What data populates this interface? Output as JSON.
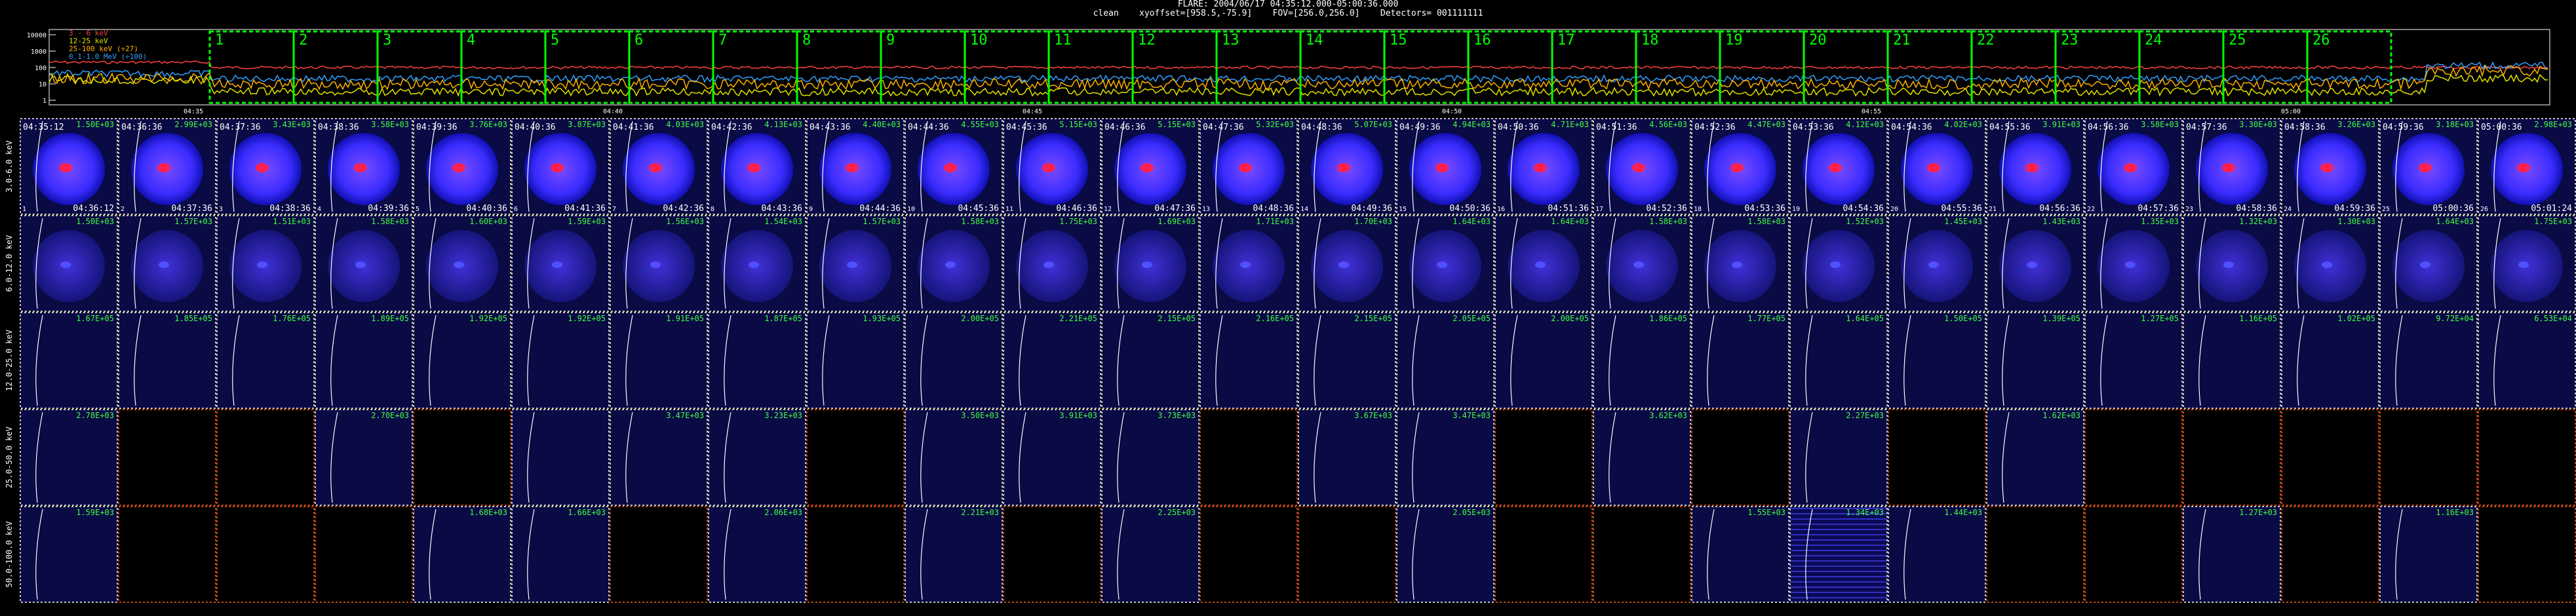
{
  "header": {
    "title": "FLARE: 2004/06/17 04:35:12.000-05:00:36.000",
    "subtitle": "clean    xyoffset=[958.5,-75.9]    FOV=[256.0,256.0]    Detectors= 001111111"
  },
  "lightcurve": {
    "y_ticks": [
      "10000",
      "1000",
      "100",
      "10",
      "1"
    ],
    "legend": [
      {
        "label": "3 - 6 keV",
        "color": "#ff4040"
      },
      {
        "label": "12-25 keV",
        "color": "#e0e000"
      },
      {
        "label": "25-100 keV (÷27)",
        "color": "#ffb000"
      },
      {
        "label": "0.1-1.0 MeV (÷100)",
        "color": "#30a0ff"
      }
    ],
    "time_ticks": [
      "04:35",
      "04:40",
      "04:45",
      "04:50",
      "04:55",
      "05:00"
    ],
    "interval_numbers": [
      "1",
      "2",
      "3",
      "4",
      "5",
      "6",
      "7",
      "8",
      "9",
      "10",
      "11",
      "12",
      "13",
      "14",
      "15",
      "16",
      "17",
      "18",
      "19",
      "20",
      "21",
      "22",
      "23",
      "24",
      "25",
      "26"
    ],
    "box_color": "#00ff00"
  },
  "energy_bands": [
    "3.0-6.0 keV",
    "6.0-12.0 keV",
    "12.0-25.0 keV",
    "25.0-50.0 keV",
    "50.0-100.0 keV"
  ],
  "time_start": [
    "04:35:12",
    "04:36:36",
    "04:37:36",
    "04:38:36",
    "04:39:36",
    "04:40:36",
    "04:41:36",
    "04:42:36",
    "04:43:36",
    "04:44:36",
    "04:45:36",
    "04:46:36",
    "04:47:36",
    "04:48:36",
    "04:49:36",
    "04:50:36",
    "04:51:36",
    "04:52:36",
    "04:53:36",
    "04:54:36",
    "04:55:36",
    "04:56:36",
    "04:57:36",
    "04:58:36",
    "04:59:36",
    "05:00:36"
  ],
  "time_end": [
    "04:36:12",
    "04:37:36",
    "04:38:36",
    "04:39:36",
    "04:40:36",
    "04:41:36",
    "04:42:36",
    "04:43:36",
    "04:44:36",
    "04:45:36",
    "04:46:36",
    "04:47:36",
    "04:48:36",
    "04:49:36",
    "04:50:36",
    "04:51:36",
    "04:52:36",
    "04:53:36",
    "04:54:36",
    "04:55:36",
    "04:56:36",
    "04:57:36",
    "04:58:36",
    "04:59:36",
    "05:00:36",
    "05:01:24"
  ],
  "row_max": [
    [
      "1.50E+03",
      "2.99E+03",
      "3.43E+03",
      "3.58E+03",
      "3.76E+03",
      "3.87E+03",
      "4.03E+03",
      "4.13E+03",
      "4.40E+03",
      "4.55E+03",
      "5.15E+03",
      "5.15E+03",
      "5.32E+03",
      "5.07E+03",
      "4.94E+03",
      "4.71E+03",
      "4.56E+03",
      "4.47E+03",
      "4.12E+03",
      "4.02E+03",
      "3.91E+03",
      "3.58E+03",
      "3.30E+03",
      "3.26E+03",
      "3.18E+03",
      "2.98E+03"
    ],
    [
      "1.50E+03",
      "1.57E+03",
      "1.51E+03",
      "1.58E+03",
      "1.60E+03",
      "1.59E+03",
      "1.56E+03",
      "1.54E+03",
      "1.57E+03",
      "1.58E+03",
      "1.75E+03",
      "1.69E+03",
      "1.71E+03",
      "1.70E+03",
      "1.64E+03",
      "1.64E+03",
      "1.58E+03",
      "1.58E+03",
      "1.52E+03",
      "1.45E+03",
      "1.43E+03",
      "1.35E+03",
      "1.32E+03",
      "1.30E+03",
      "1.64E+03",
      "1.75E+03"
    ],
    [
      "1.67E+05",
      "1.85E+05",
      "1.76E+05",
      "1.89E+05",
      "1.92E+05",
      "1.92E+05",
      "1.91E+05",
      "1.87E+05",
      "1.93E+05",
      "2.00E+05",
      "2.21E+05",
      "2.15E+05",
      "2.16E+05",
      "2.15E+05",
      "2.05E+05",
      "2.00E+05",
      "1.86E+05",
      "1.77E+05",
      "1.64E+05",
      "1.50E+05",
      "1.39E+05",
      "1.27E+05",
      "1.16E+05",
      "1.02E+05",
      "9.72E+04",
      "6.53E+04"
    ],
    [
      "2.78E+03",
      "",
      "",
      "2.70E+03",
      "",
      "",
      "3.47E+03",
      "3.23E+03",
      "",
      "3.50E+03",
      "3.91E+03",
      "3.73E+03",
      "",
      "3.67E+03",
      "3.47E+03",
      "",
      "3.62E+03",
      "",
      "2.27E+03",
      "",
      "1.62E+03",
      "",
      "",
      "",
      "",
      ""
    ],
    [
      "1.59E+03",
      "",
      "",
      "",
      "1.68E+03",
      "1.66E+03",
      "",
      "2.06E+03",
      "",
      "2.21E+03",
      "",
      "2.25E+03",
      "",
      "",
      "2.05E+03",
      "",
      "",
      "1.55E+03",
      "1.34E+03",
      "1.44E+03",
      "",
      "",
      "1.27E+03",
      "",
      "1.16E+03",
      ""
    ]
  ],
  "row_types": [
    [
      "sun",
      "sun",
      "sun",
      "sun",
      "sun",
      "sun",
      "sun",
      "sun",
      "sun",
      "sun",
      "sun",
      "sun",
      "sun",
      "sun",
      "sun",
      "sun",
      "sun",
      "sun",
      "sun",
      "sun",
      "sun",
      "sun",
      "sun",
      "sun",
      "sun",
      "sun"
    ],
    [
      "sun",
      "sun",
      "sun",
      "sun",
      "sun",
      "sun",
      "sun",
      "sun",
      "sun",
      "sun",
      "sun",
      "sun",
      "sun",
      "sun",
      "sun",
      "sun",
      "sun",
      "sun",
      "sun",
      "sun",
      "sun",
      "sun",
      "sun",
      "sun",
      "sun",
      "sun"
    ],
    [
      "dim",
      "dim",
      "dim",
      "dim",
      "dim",
      "dim",
      "dim",
      "dim",
      "dim",
      "dim",
      "dim",
      "dim",
      "dim",
      "dim",
      "dim",
      "dim",
      "dim",
      "dim",
      "dim",
      "dim",
      "dim",
      "dim",
      "dim",
      "dim",
      "dim",
      "dim"
    ],
    [
      "dim",
      "black",
      "black",
      "dim",
      "black",
      "dim",
      "dim",
      "dim",
      "black",
      "dim",
      "dim",
      "dim",
      "black",
      "dim",
      "dim",
      "black",
      "dim",
      "black",
      "dim",
      "black",
      "dim",
      "black",
      "black",
      "black",
      "black",
      "black"
    ],
    [
      "dim",
      "black",
      "black",
      "black",
      "dim",
      "dim",
      "black",
      "dim",
      "black",
      "dim",
      "black",
      "dim",
      "black",
      "black",
      "dim",
      "black",
      "black",
      "dim",
      "stripe",
      "dim",
      "black",
      "black",
      "dim",
      "black",
      "dim",
      "black"
    ]
  ]
}
